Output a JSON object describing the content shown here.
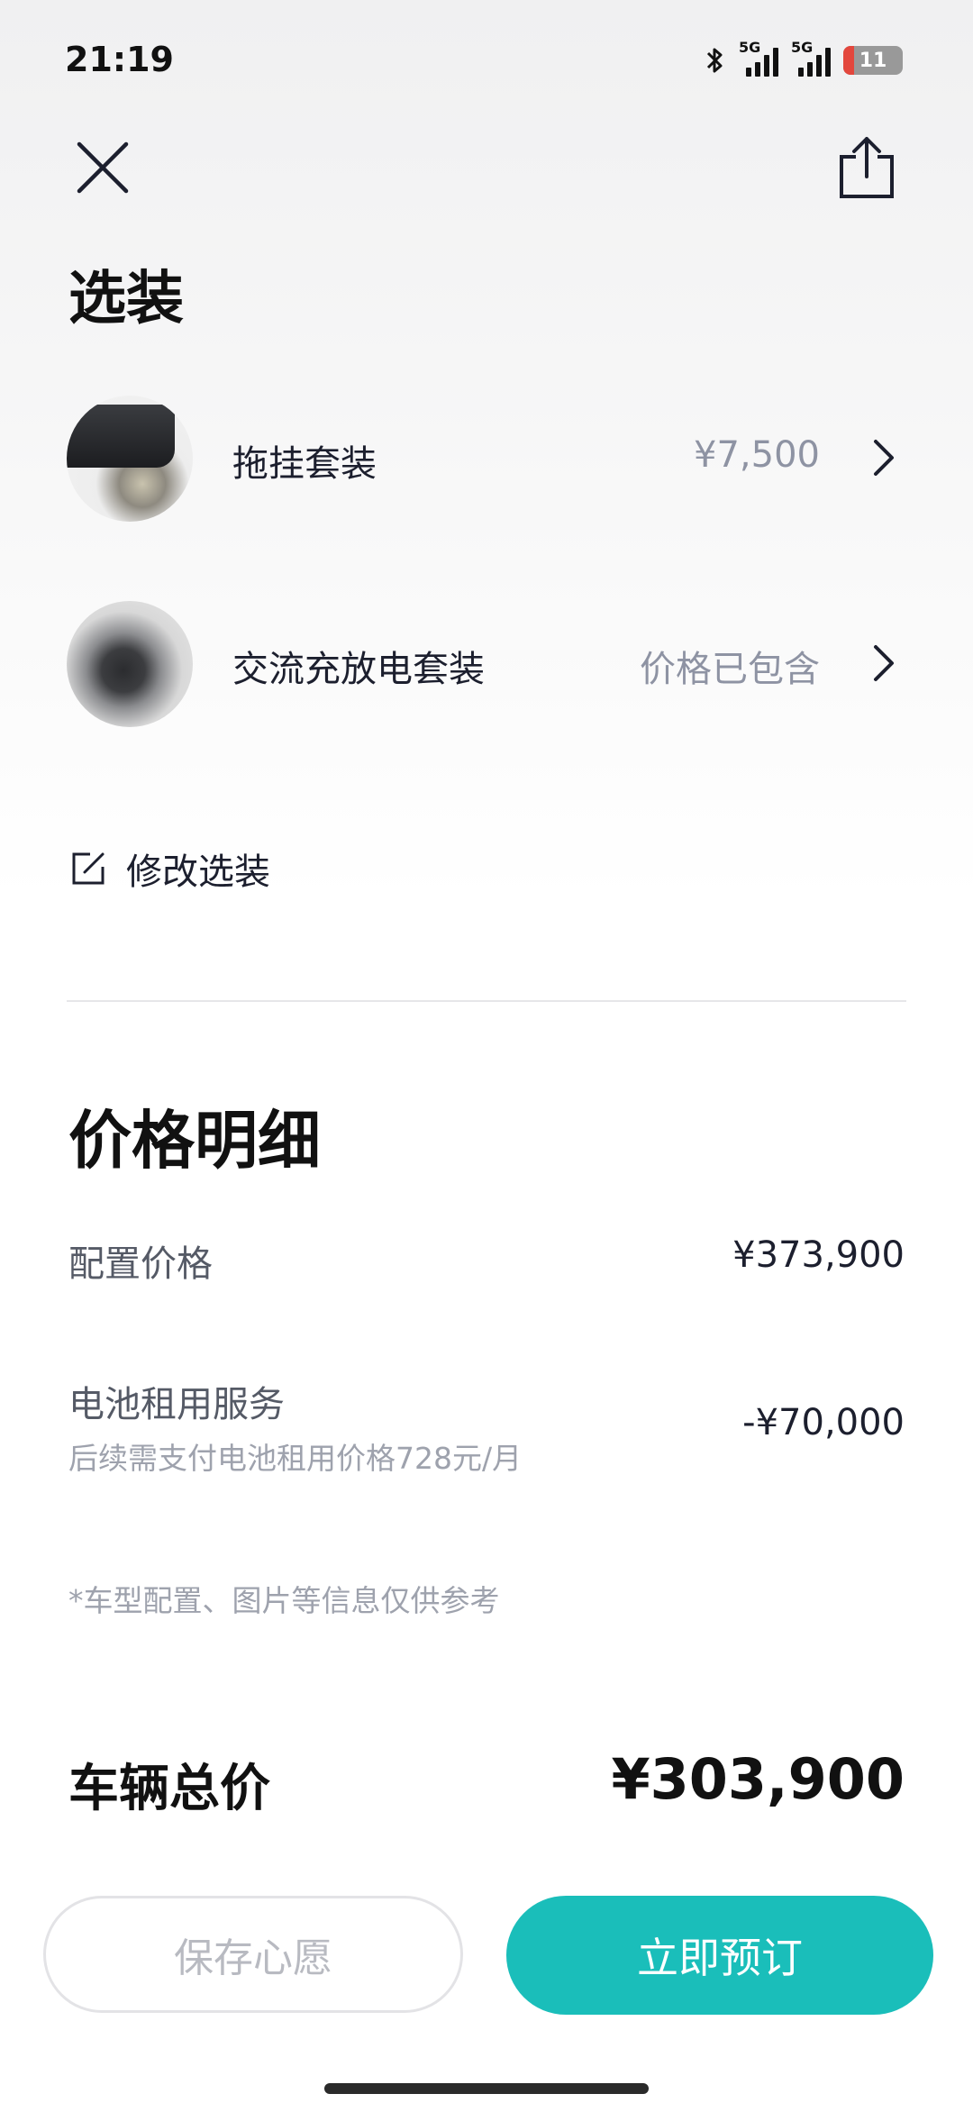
{
  "status_bar": {
    "time": "21:19",
    "net1": "5G",
    "net2": "5G",
    "battery": "11"
  },
  "options_section": {
    "title": "选装",
    "items": [
      {
        "name": "拖挂套装",
        "price": "¥7,500"
      },
      {
        "name": "交流充放电套装",
        "price": "价格已包含"
      }
    ],
    "modify_label": "修改选装"
  },
  "price_section": {
    "title": "价格明细",
    "config_label": "配置价格",
    "config_value": "¥373,900",
    "battery_label": "电池租用服务",
    "battery_sub": "后续需支付电池租用价格728元/月",
    "battery_value": "-¥70,000",
    "note": "*车型配置、图片等信息仅供参考"
  },
  "total": {
    "label": "车辆总价",
    "value": "¥303,900"
  },
  "buttons": {
    "save": "保存心愿",
    "order": "立即预订"
  },
  "colors": {
    "accent": "#1abeba",
    "muted": "#9ea2ad"
  }
}
